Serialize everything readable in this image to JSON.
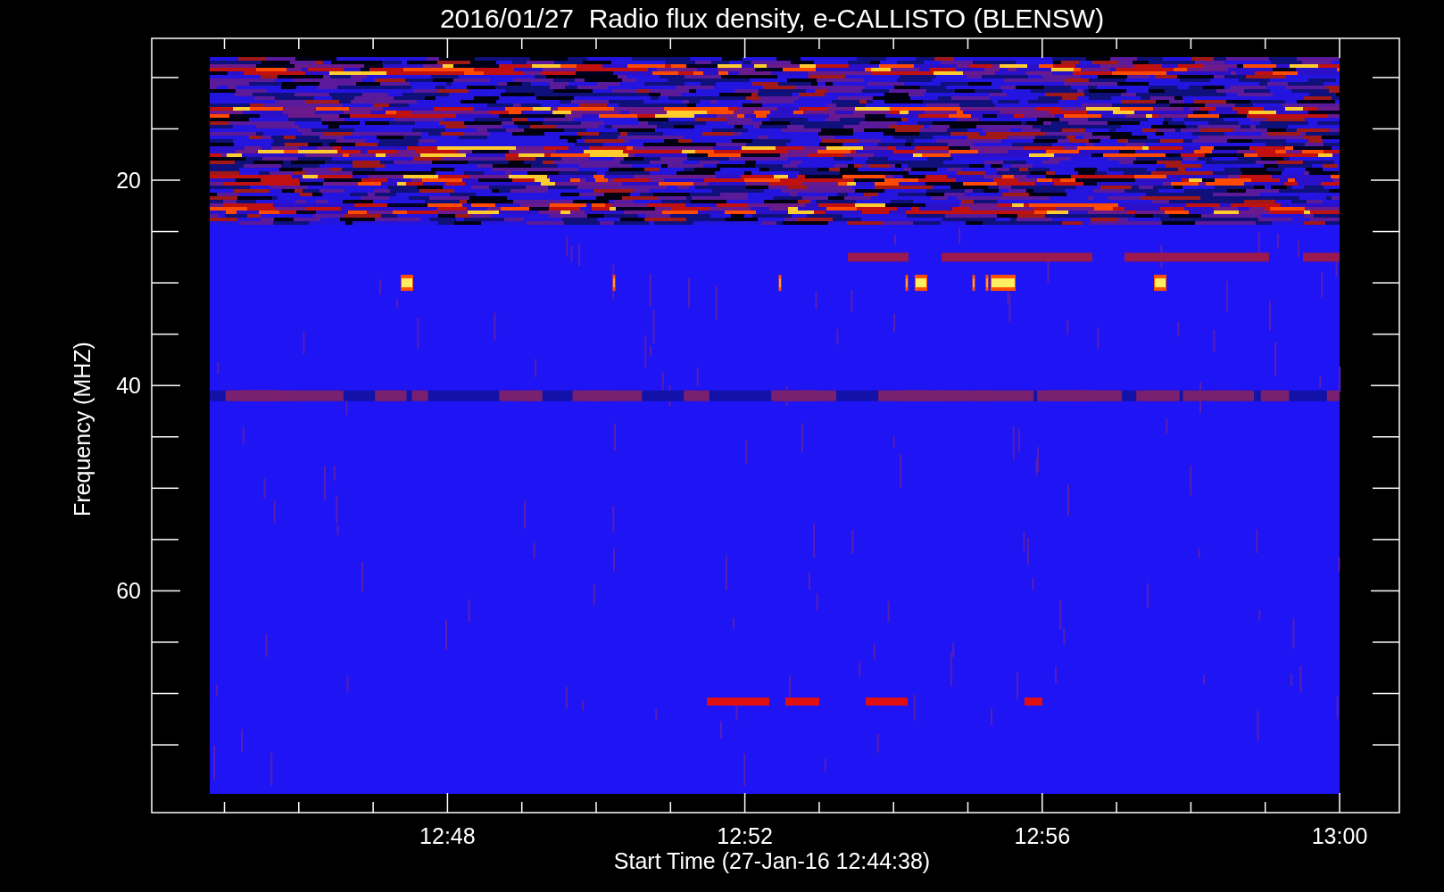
{
  "title": "2016/01/27  Radio flux density, e-CALLISTO (BLENSW)",
  "y_axis": {
    "label": "Frequency (MHZ)",
    "tick_labels": [
      "20",
      "40",
      "60"
    ]
  },
  "x_axis": {
    "label": "Start Time (27-Jan-16 12:44:38)",
    "tick_labels": [
      "12:48",
      "12:52",
      "12:56",
      "13:00"
    ]
  }
}
